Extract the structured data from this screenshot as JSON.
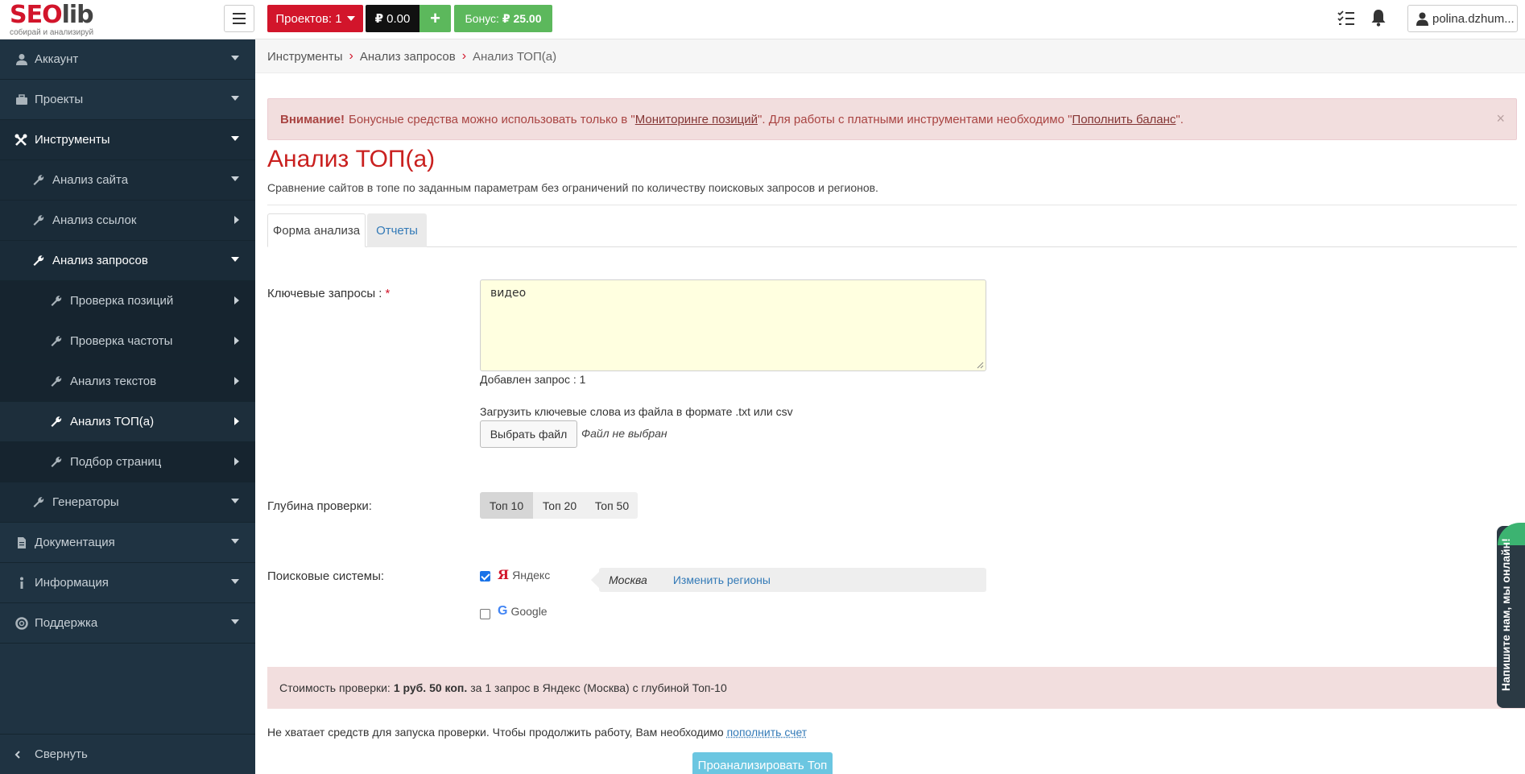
{
  "logo": {
    "main_part1": "SEO",
    "main_part2": "lib",
    "tagline": "собирай и анализируй"
  },
  "topbar": {
    "projects_label": "Проектов: 1",
    "balance_label": "0.00",
    "currency_symbol": "₽",
    "plus_label": "+",
    "bonus_label": "Бонус:",
    "bonus_value": "25.00",
    "user_label": "polina.dzhum..."
  },
  "sidebar": {
    "items": [
      {
        "label": "Аккаунт"
      },
      {
        "label": "Проекты"
      },
      {
        "label": "Инструменты"
      },
      {
        "label": "Анализ сайта"
      },
      {
        "label": "Анализ ссылок"
      },
      {
        "label": "Анализ запросов"
      },
      {
        "label": "Проверка позиций"
      },
      {
        "label": "Проверка частоты"
      },
      {
        "label": "Анализ текстов"
      },
      {
        "label": "Анализ ТОП(а)"
      },
      {
        "label": "Подбор страниц"
      },
      {
        "label": "Генераторы"
      },
      {
        "label": "Документация"
      },
      {
        "label": "Информация"
      },
      {
        "label": "Поддержка"
      }
    ],
    "collapse_label": "Свернуть"
  },
  "breadcrumb": {
    "items": [
      "Инструменты",
      "Анализ запросов",
      "Анализ ТОП(а)"
    ]
  },
  "alert": {
    "strong": "Внимание!",
    "text1": "Бонусные средства можно использовать только в \"",
    "link1": "Мониторинге позиций",
    "text2": "\". Для работы с платными инструментами необходимо \"",
    "link2": "Пополнить баланс",
    "text3": "\".",
    "close": "×"
  },
  "page": {
    "title": "Анализ ТОП(а)",
    "description": "Сравнение сайтов в топе по заданным параметрам без ограничений по количеству поисковых запросов и регионов."
  },
  "tabs": {
    "form": "Форма анализа",
    "reports": "Отчеты"
  },
  "form": {
    "keywords_label": "Ключевые запросы :",
    "required_mark": "*",
    "keywords_value": "видео",
    "added_count": "Добавлен запрос : 1",
    "upload_label": "Загрузить ключевые слова из файла в формате .txt или csv",
    "file_button": "Выбрать файл",
    "file_status": "Файл не выбран",
    "depth_label": "Глубина проверки:",
    "depth_options": [
      "Топ 10",
      "Топ 20",
      "Топ 50"
    ],
    "engines_label": "Поисковые системы:",
    "yandex_letter": "Я",
    "yandex_label": "Яндекс",
    "yandex_checked": true,
    "google_letter": "G",
    "google_label": "Google",
    "google_checked": false,
    "region_name": "Москва",
    "change_regions": "Изменить регионы"
  },
  "cost": {
    "prefix": "Стоимость проверки:",
    "amount": "1 руб. 50 коп.",
    "suffix": "за 1 запрос в Яндекс (Москва) с глубиной Топ-10"
  },
  "no_funds": {
    "text": "Не хватает средств для запуска проверки. Чтобы продолжить работу, Вам необходимо ",
    "link": "пополнить счет"
  },
  "submit_label": "Проанализировать Топ",
  "chat": {
    "label": "Напишите нам, мы онлайн!"
  },
  "colors": {
    "brand_red": "#d2152b",
    "sidebar_bg": "#1f3342",
    "green": "#5cb85c",
    "link": "#337ab7",
    "alert_bg": "#f2dede"
  }
}
